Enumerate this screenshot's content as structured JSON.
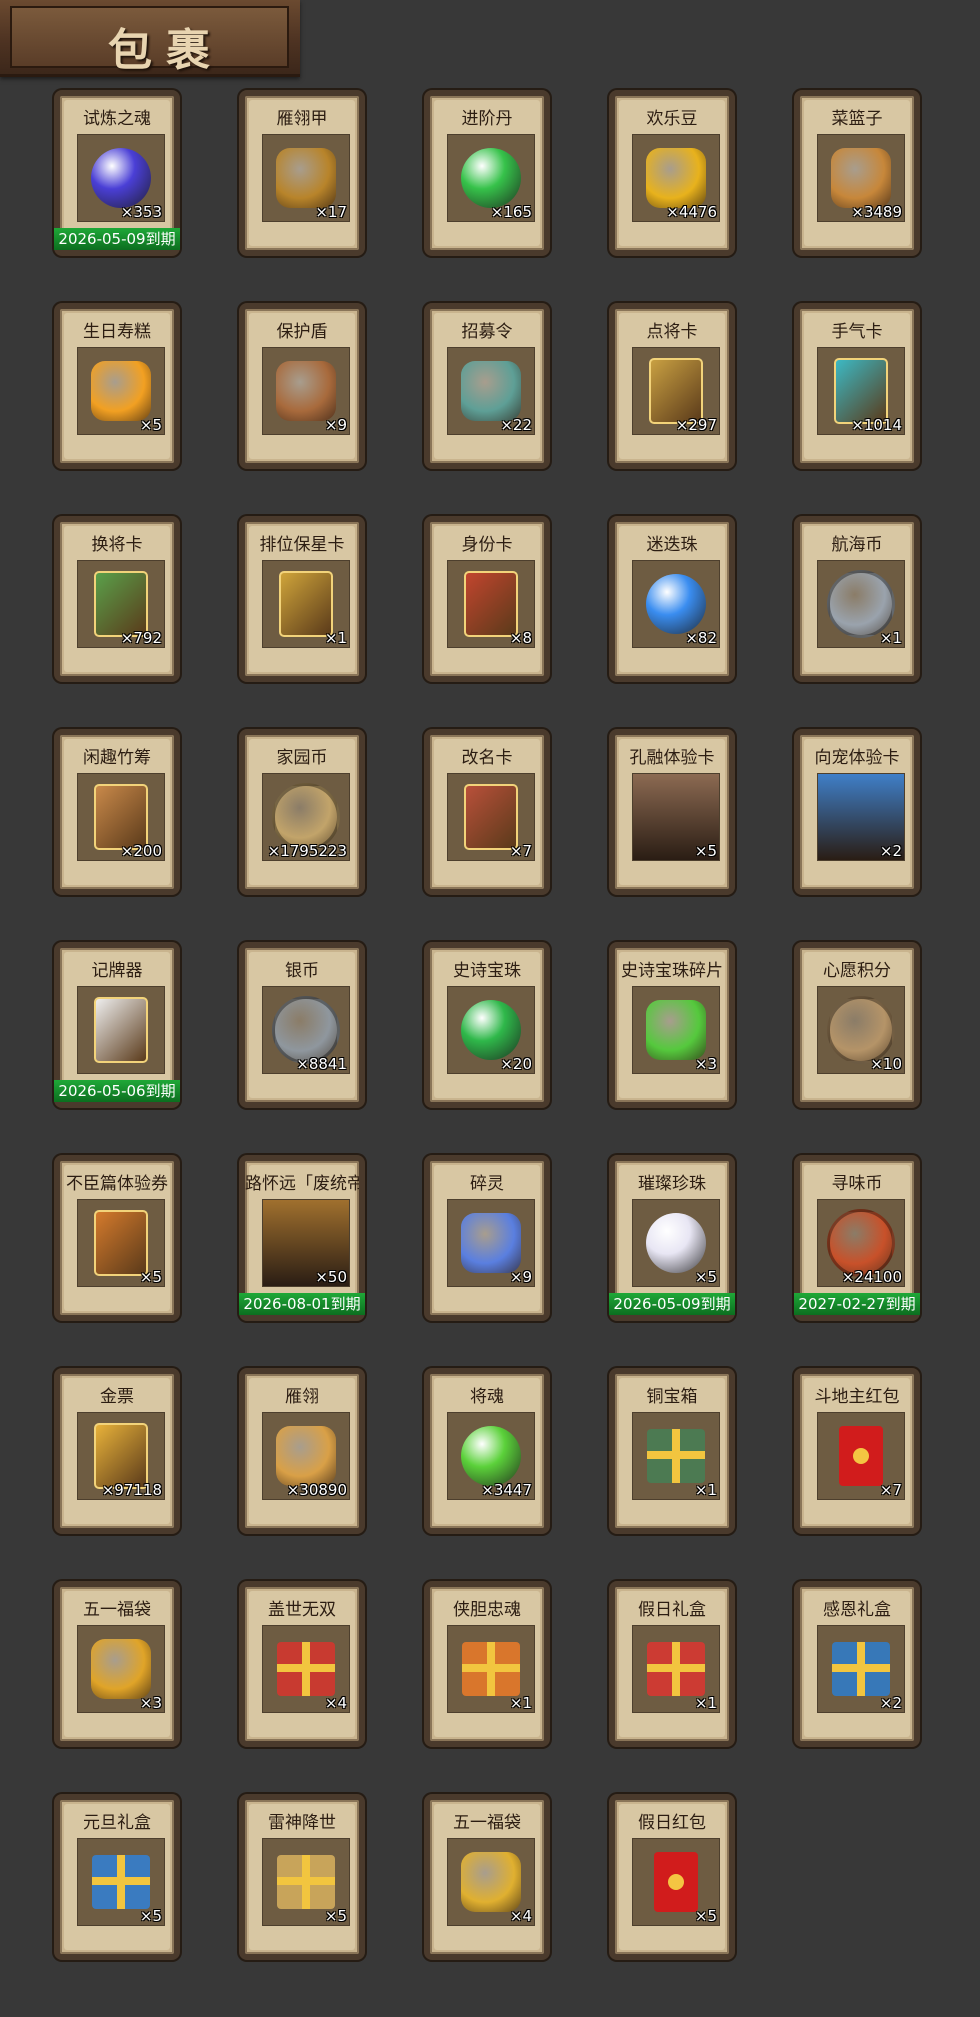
{
  "header": {
    "title": "包裹"
  },
  "items": [
    {
      "name": "试炼之魂",
      "count": "×353",
      "expiry": "2026-05-09到期",
      "icon": "spirit-orb-icon",
      "color": "#4a3fd6"
    },
    {
      "name": "雁翎甲",
      "count": "×17",
      "expiry": "",
      "icon": "armor-icon",
      "color": "#b8842a"
    },
    {
      "name": "进阶丹",
      "count": "×165",
      "expiry": "",
      "icon": "green-pill-icon",
      "color": "#36c24a"
    },
    {
      "name": "欢乐豆",
      "count": "×4476",
      "expiry": "",
      "icon": "golden-beans-icon",
      "color": "#e8b21c"
    },
    {
      "name": "菜篮子",
      "count": "×3489",
      "expiry": "",
      "icon": "vegetable-basket-icon",
      "color": "#c7873a"
    },
    {
      "name": "生日寿糕",
      "count": "×5",
      "expiry": "",
      "icon": "birthday-cake-icon",
      "color": "#f2a022"
    },
    {
      "name": "保护盾",
      "count": "×9",
      "expiry": "",
      "icon": "shield-icon",
      "color": "#a86a3c"
    },
    {
      "name": "招募令",
      "count": "×22",
      "expiry": "",
      "icon": "recruit-token-icon",
      "color": "#5e9f96"
    },
    {
      "name": "点将卡",
      "count": "×297",
      "expiry": "",
      "icon": "general-card-icon",
      "color": "#c9a042"
    },
    {
      "name": "手气卡",
      "count": "×1014",
      "expiry": "",
      "icon": "luck-card-icon",
      "color": "#3cb9c4"
    },
    {
      "name": "换将卡",
      "count": "×792",
      "expiry": "",
      "icon": "swap-general-card-icon",
      "color": "#5aa04a"
    },
    {
      "name": "排位保星卡",
      "count": "×1",
      "expiry": "",
      "icon": "rank-star-card-icon",
      "color": "#cfa43a"
    },
    {
      "name": "身份卡",
      "count": "×8",
      "expiry": "",
      "icon": "identity-card-icon",
      "color": "#c2452e"
    },
    {
      "name": "迷迭珠",
      "count": "×82",
      "expiry": "",
      "icon": "blue-orb-icon",
      "color": "#3a8df0"
    },
    {
      "name": "航海币",
      "count": "×1",
      "expiry": "",
      "icon": "silver-ship-coin-icon",
      "color": "#9aa3ad"
    },
    {
      "name": "闲趣竹筹",
      "count": "×200",
      "expiry": "",
      "icon": "bamboo-tally-icon",
      "color": "#c9894a"
    },
    {
      "name": "家园币",
      "count": "×1795223",
      "expiry": "",
      "icon": "home-coin-icon",
      "color": "#c2a46a"
    },
    {
      "name": "改名卡",
      "count": "×7",
      "expiry": "",
      "icon": "rename-card-icon",
      "color": "#b9503a"
    },
    {
      "name": "孔融体验卡",
      "count": "×5",
      "expiry": "",
      "icon": "kongrong-portrait-icon",
      "color": "#8c6a52"
    },
    {
      "name": "向宠体验卡",
      "count": "×2",
      "expiry": "",
      "icon": "xiangchong-portrait-icon",
      "color": "#3f7fc8"
    },
    {
      "name": "记牌器",
      "count": "",
      "expiry": "2026-05-06到期",
      "icon": "playing-cards-icon",
      "color": "#eeeeee"
    },
    {
      "name": "银币",
      "count": "×8841",
      "expiry": "",
      "icon": "silver-coins-icon",
      "color": "#8f979e"
    },
    {
      "name": "史诗宝珠",
      "count": "×20",
      "expiry": "",
      "icon": "green-epic-orb-icon",
      "color": "#2fb84a"
    },
    {
      "name": "史诗宝珠碎片",
      "count": "×3",
      "expiry": "",
      "icon": "green-shard-icon",
      "color": "#55c93d"
    },
    {
      "name": "心愿积分",
      "count": "×10",
      "expiry": "",
      "icon": "heart-coin-icon",
      "color": "#b59468"
    },
    {
      "name": "不臣篇体验券",
      "count": "×5",
      "expiry": "",
      "icon": "coupon-icon",
      "color": "#d47a2c"
    },
    {
      "name": "路怀远「废统帝」",
      "count": "×50",
      "expiry": "2026-08-01到期",
      "icon": "hero-portrait-icon",
      "color": "#a0702e"
    },
    {
      "name": "碎灵",
      "count": "×9",
      "expiry": "",
      "icon": "crystal-shard-icon",
      "color": "#5a7fe0"
    },
    {
      "name": "璀璨珍珠",
      "count": "×5",
      "expiry": "2026-05-09到期",
      "icon": "pearl-icon",
      "color": "#e8e6f4"
    },
    {
      "name": "寻味币",
      "count": "×24100",
      "expiry": "2027-02-27到期",
      "icon": "taste-coin-icon",
      "color": "#c8512a"
    },
    {
      "name": "金票",
      "count": "×97118",
      "expiry": "",
      "icon": "gold-ticket-icon",
      "color": "#e8b23a"
    },
    {
      "name": "雁翎",
      "count": "×30890",
      "expiry": "",
      "icon": "feather-icon",
      "color": "#d9a047"
    },
    {
      "name": "将魂",
      "count": "×3447",
      "expiry": "",
      "icon": "green-soul-icon",
      "color": "#5bd13a"
    },
    {
      "name": "铜宝箱",
      "count": "×1",
      "expiry": "",
      "icon": "copper-chest-icon",
      "color": "#4c7a52"
    },
    {
      "name": "斗地主红包",
      "count": "×7",
      "expiry": "",
      "icon": "red-envelope-icon",
      "color": "#d11c1c"
    },
    {
      "name": "五一福袋",
      "count": "×3",
      "expiry": "",
      "icon": "lucky-bag-icon",
      "color": "#e0a428"
    },
    {
      "name": "盖世无双",
      "count": "×4",
      "expiry": "",
      "icon": "red-gift-box-icon",
      "color": "#c83a30"
    },
    {
      "name": "侠胆忠魂",
      "count": "×1",
      "expiry": "",
      "icon": "orange-gift-box-icon",
      "color": "#d9762c"
    },
    {
      "name": "假日礼盒",
      "count": "×1",
      "expiry": "",
      "icon": "red-gift-box-icon",
      "color": "#cc3b33"
    },
    {
      "name": "感恩礼盒",
      "count": "×2",
      "expiry": "",
      "icon": "blue-gift-box-icon",
      "color": "#3778b8"
    },
    {
      "name": "元旦礼盒",
      "count": "×5",
      "expiry": "",
      "icon": "blue-gift-box-icon",
      "color": "#3a7bc0"
    },
    {
      "name": "雷神降世",
      "count": "×5",
      "expiry": "",
      "icon": "gold-gift-box-icon",
      "color": "#c8a45a"
    },
    {
      "name": "五一福袋",
      "count": "×4",
      "expiry": "",
      "icon": "lucky-bag-icon",
      "color": "#e0b030"
    },
    {
      "name": "假日红包",
      "count": "×5",
      "expiry": "",
      "icon": "red-envelope-icon",
      "color": "#d01e22"
    }
  ]
}
